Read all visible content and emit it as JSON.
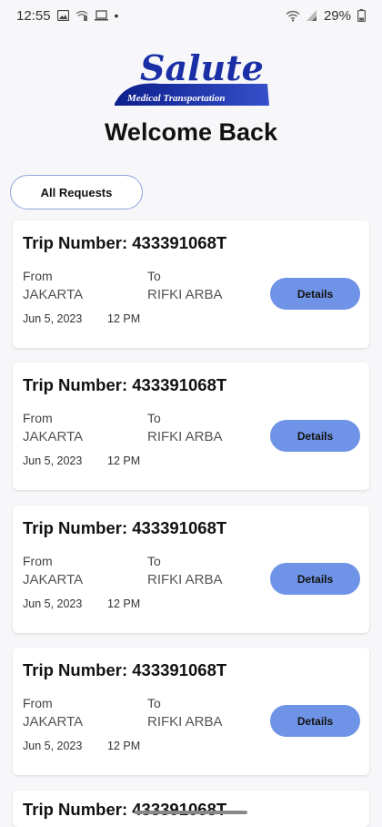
{
  "status_bar": {
    "time": "12:55",
    "dot": "•",
    "battery": "29%"
  },
  "logo": {
    "word": "Salute",
    "tagline": "Medical Transportation"
  },
  "header": {
    "welcome": "Welcome Back"
  },
  "filter": {
    "label": "All Requests"
  },
  "trips": [
    {
      "title": "Trip Number: 433391068T",
      "from_label": "From",
      "from": "JAKARTA",
      "to_label": "To",
      "to": "RIFKI ARBA",
      "date": "Jun 5, 2023",
      "time": "12 PM",
      "button": "Details"
    },
    {
      "title": "Trip Number: 433391068T",
      "from_label": "From",
      "from": "JAKARTA",
      "to_label": "To",
      "to": "RIFKI ARBA",
      "date": "Jun 5, 2023",
      "time": "12 PM",
      "button": "Details"
    },
    {
      "title": "Trip Number: 433391068T",
      "from_label": "From",
      "from": "JAKARTA",
      "to_label": "To",
      "to": "RIFKI ARBA",
      "date": "Jun 5, 2023",
      "time": "12 PM",
      "button": "Details"
    },
    {
      "title": "Trip Number: 433391068T",
      "from_label": "From",
      "from": "JAKARTA",
      "to_label": "To",
      "to": "RIFKI ARBA",
      "date": "Jun 5, 2023",
      "time": "12 PM",
      "button": "Details"
    },
    {
      "title": "Trip Number: 433391068T"
    }
  ],
  "colors": {
    "accent": "#6f93e6",
    "logo_blue": "#1a2fa6"
  }
}
